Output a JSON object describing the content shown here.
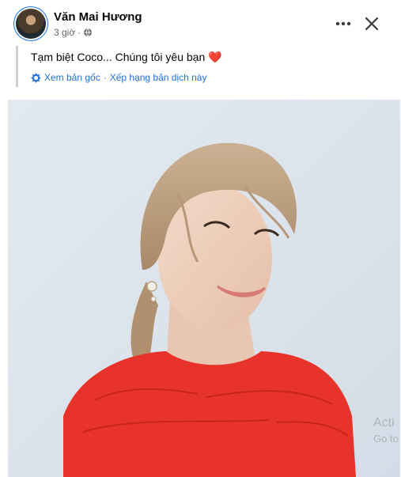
{
  "post": {
    "author": "Văn Mai Hương",
    "time": "3 giờ",
    "time_separator": "·",
    "text": "Tạm biệt Coco... Chúng tôi yêu bạn",
    "emoji": "❤️",
    "see_original": "Xem bản gốc",
    "separator": "·",
    "rate_translation": "Xếp hạng bản dịch này"
  },
  "watermark": {
    "line1": "Acti",
    "line2": "Go to"
  },
  "icons": {
    "globe": "globe-icon",
    "more": "more-icon",
    "close": "close-icon",
    "translate": "translate-gear-icon"
  },
  "colors": {
    "link": "#216fdb",
    "secondary_text": "#65676b",
    "primary_text": "#050505",
    "heart": "#e0245e",
    "photo_background": "#dde4ec",
    "dress": "#e8332a"
  }
}
